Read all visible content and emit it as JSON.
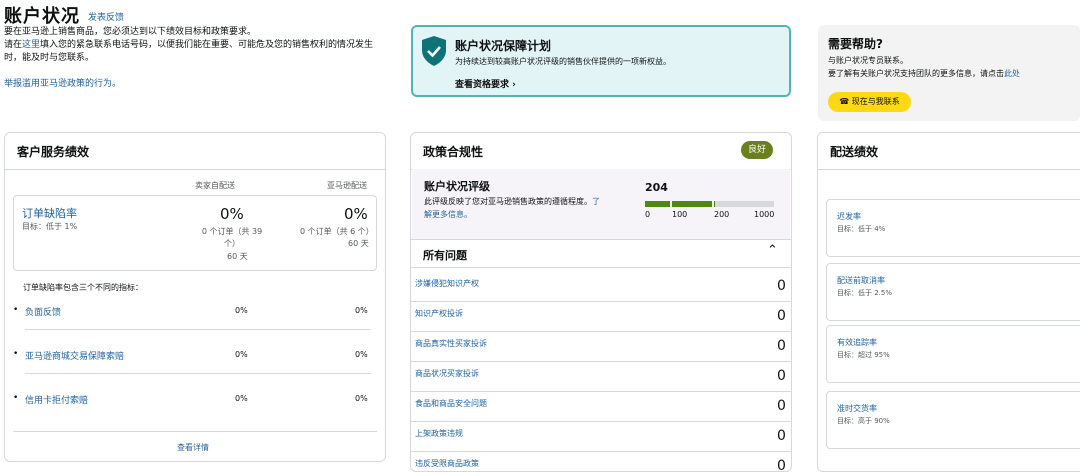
{
  "header": {
    "title": "账户状况",
    "feedback_link": "发表反馈",
    "intro_line1": "要在亚马逊上销售商品，您必须达到以下绩效目标和政策要求。",
    "intro_line2_prefix": "请在",
    "intro_line2_link": "这里",
    "intro_line2_suffix": "填入您的紧急联系电话号码，以便我们能在重要、可能危及您的销售权利的情况发生时，能及时与您联系。",
    "report_link": "举报滥用亚马逊政策的行为。"
  },
  "protection_card": {
    "title": "账户状况保障计划",
    "description": "为持续达到较高账户状况评级的销售伙伴提供的一项新权益。",
    "link": "查看资格要求",
    "icon": "shield-check-icon",
    "accent": "#4fb5b8"
  },
  "help_card": {
    "title": "需要帮助?",
    "line1": "与账户状况专员联系。",
    "line2_prefix": "要了解有关账户状况支持团队的更多信息，请点击",
    "line2_link": "此处",
    "button": "现在与我联系",
    "button_color": "#ffd814"
  },
  "customer_service": {
    "title": "客户服务绩效",
    "col_seller": "卖家自配送",
    "col_amazon": "亚马逊配送",
    "odr": {
      "name": "订单缺陷率",
      "target": "目标：低于 1%",
      "seller_value": "0%",
      "seller_detail1": "0 个订单（共 39",
      "seller_detail2": "个）",
      "seller_period": "60 天",
      "amazon_value": "0%",
      "amazon_detail": "0 个订单（共 6 个）",
      "amazon_period": "60 天"
    },
    "sub_intro": "订单缺陷率包含三个不同的指标：",
    "sub_metrics": [
      {
        "name": "负面反馈",
        "seller": "0%",
        "amazon": "0%"
      },
      {
        "name": "亚马逊商城交易保障索赔",
        "seller": "0%",
        "amazon": "0%"
      },
      {
        "name": "信用卡拒付索赔",
        "seller": "0%",
        "amazon": "0%"
      }
    ],
    "details_link": "查看详情"
  },
  "policy": {
    "title": "政策合规性",
    "badge": "良好",
    "badge_color": "#6a7f1d",
    "rating_title": "账户状况评级",
    "rating_desc1": "此评级反映了您对亚马逊销售政策的遵循程度。",
    "rating_desc_link1": "了",
    "rating_desc_link2": "解更多信息。",
    "score": "204",
    "score_value": 204,
    "scale_labels": [
      "0",
      "100",
      "200",
      "1000"
    ],
    "bar_color": "#4b8a0f",
    "issues_title": "所有问题",
    "issues": [
      {
        "name": "涉嫌侵犯知识产权",
        "count": "0"
      },
      {
        "name": "知识产权投诉",
        "count": "0"
      },
      {
        "name": "商品真实性买家投诉",
        "count": "0"
      },
      {
        "name": "商品状况买家投诉",
        "count": "0"
      },
      {
        "name": "食品和商品安全问题",
        "count": "0"
      },
      {
        "name": "上架政策违规",
        "count": "0"
      },
      {
        "name": "违反受限商品政策",
        "count": "0"
      }
    ]
  },
  "shipping": {
    "title": "配送绩效",
    "metrics": [
      {
        "name": "迟发率",
        "target": "目标：低于 4%"
      },
      {
        "name": "配送前取消率",
        "target": "目标：低于 2.5%"
      },
      {
        "name": "有效追踪率",
        "target": "目标：超过 95%"
      },
      {
        "name": "准时交货率",
        "target": "目标：高于 90%"
      }
    ]
  }
}
